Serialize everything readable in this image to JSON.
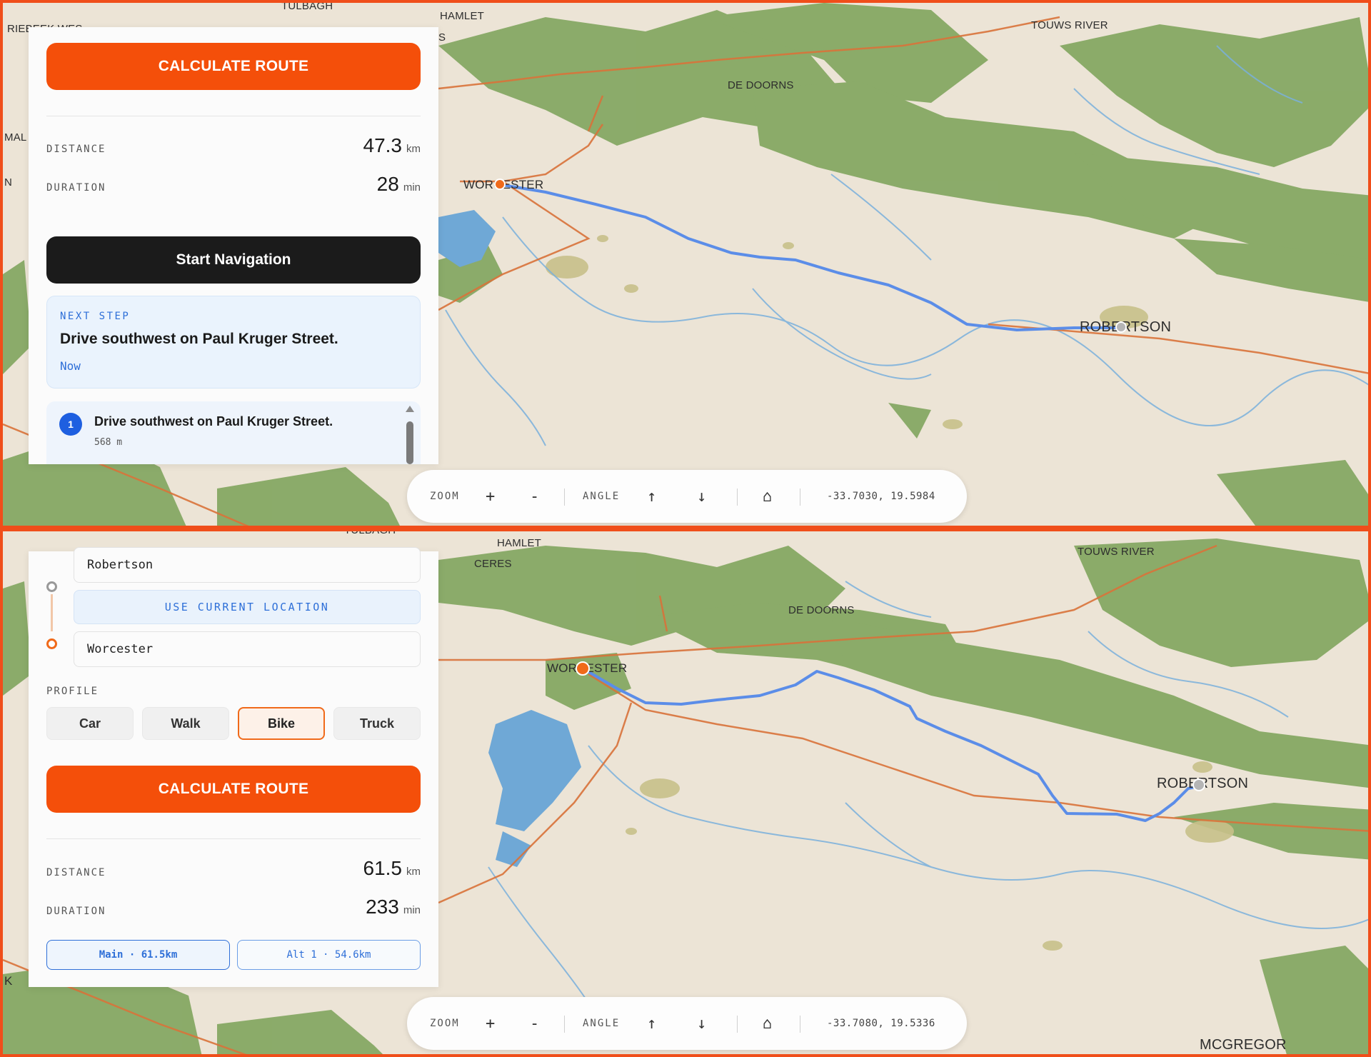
{
  "top": {
    "towns": [
      "TULBAGH",
      "RIEBEEK WES",
      "HAMLET",
      "S",
      "TOUWS RIVER",
      "DE DOORNS",
      "WORCESTER",
      "ROBERTSON",
      "MAL",
      "N"
    ],
    "panel": {
      "calculate_label": "CALCULATE ROUTE",
      "distance_label": "DISTANCE",
      "distance_value": "47.3",
      "distance_unit": "km",
      "duration_label": "DURATION",
      "duration_value": "28",
      "duration_unit": "min",
      "start_nav_label": "Start Navigation",
      "next_step": {
        "label": "NEXT STEP",
        "text": "Drive southwest on Paul Kruger Street.",
        "when": "Now"
      },
      "steps": [
        {
          "num": "1",
          "text": "Drive southwest on Paul Kruger Street.",
          "distance": "568 m"
        }
      ]
    },
    "controls": {
      "zoom_label": "ZOOM",
      "zoom_in": "+",
      "zoom_out": "-",
      "angle_label": "ANGLE",
      "angle_up": "↑",
      "angle_down": "↓",
      "home": "⌂",
      "coords": "-33.7030, 19.5984"
    }
  },
  "bottom": {
    "towns": [
      "TULBAGH",
      "HAMLET",
      "CERES",
      "TOUWS RIVER",
      "DE DOORNS",
      "WORCESTER",
      "ROBERTSON",
      "MCGREGOR",
      "K"
    ],
    "panel": {
      "origin_value": "Robertson",
      "use_location_label": "USE CURRENT LOCATION",
      "destination_value": "Worcester",
      "profile_label": "PROFILE",
      "profiles": [
        "Car",
        "Walk",
        "Bike",
        "Truck"
      ],
      "active_profile": "Bike",
      "calculate_label": "CALCULATE ROUTE",
      "distance_label": "DISTANCE",
      "distance_value": "61.5",
      "distance_unit": "km",
      "duration_label": "DURATION",
      "duration_value": "233",
      "duration_unit": "min",
      "routes": [
        "Main · 61.5km",
        "Alt 1 · 54.6km"
      ]
    },
    "controls": {
      "zoom_label": "ZOOM",
      "zoom_in": "+",
      "zoom_out": "-",
      "angle_label": "ANGLE",
      "angle_up": "↑",
      "angle_down": "↓",
      "home": "⌂",
      "coords": "-33.7080, 19.5336"
    }
  },
  "colors": {
    "accent": "#f44f0a",
    "route": "#5b8de8",
    "vegetation": "#86a864",
    "land": "#ece4d6",
    "water": "#6fa8d6"
  }
}
